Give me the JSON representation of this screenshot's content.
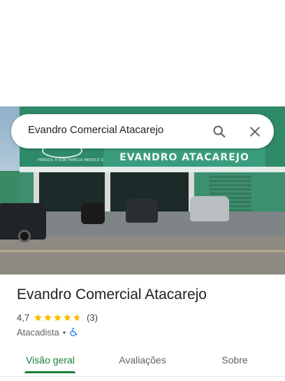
{
  "search": {
    "query": "Evandro Comercial Atacarejo"
  },
  "photo": {
    "storefront_sign": "EVANDRO ATACAREJO",
    "small_sign": "PENSOU A SUA FAMÍLIA MERECE O MELHOR"
  },
  "place": {
    "name": "Evandro Comercial Atacarejo",
    "rating": "4,7",
    "stars": 4.7,
    "reviews": "(3)",
    "category": "Atacadista",
    "separator": "•"
  },
  "tabs": [
    {
      "label": "Visão geral",
      "active": true
    },
    {
      "label": "Avaliações",
      "active": false
    },
    {
      "label": "Sobre",
      "active": false
    }
  ],
  "colors": {
    "accent": "#188038",
    "star": "#fbbc04",
    "accessibility_icon": "#1a73e8"
  },
  "icons": {
    "search": "search-icon",
    "close": "close-icon",
    "accessibility": "wheelchair-accessible-icon"
  }
}
